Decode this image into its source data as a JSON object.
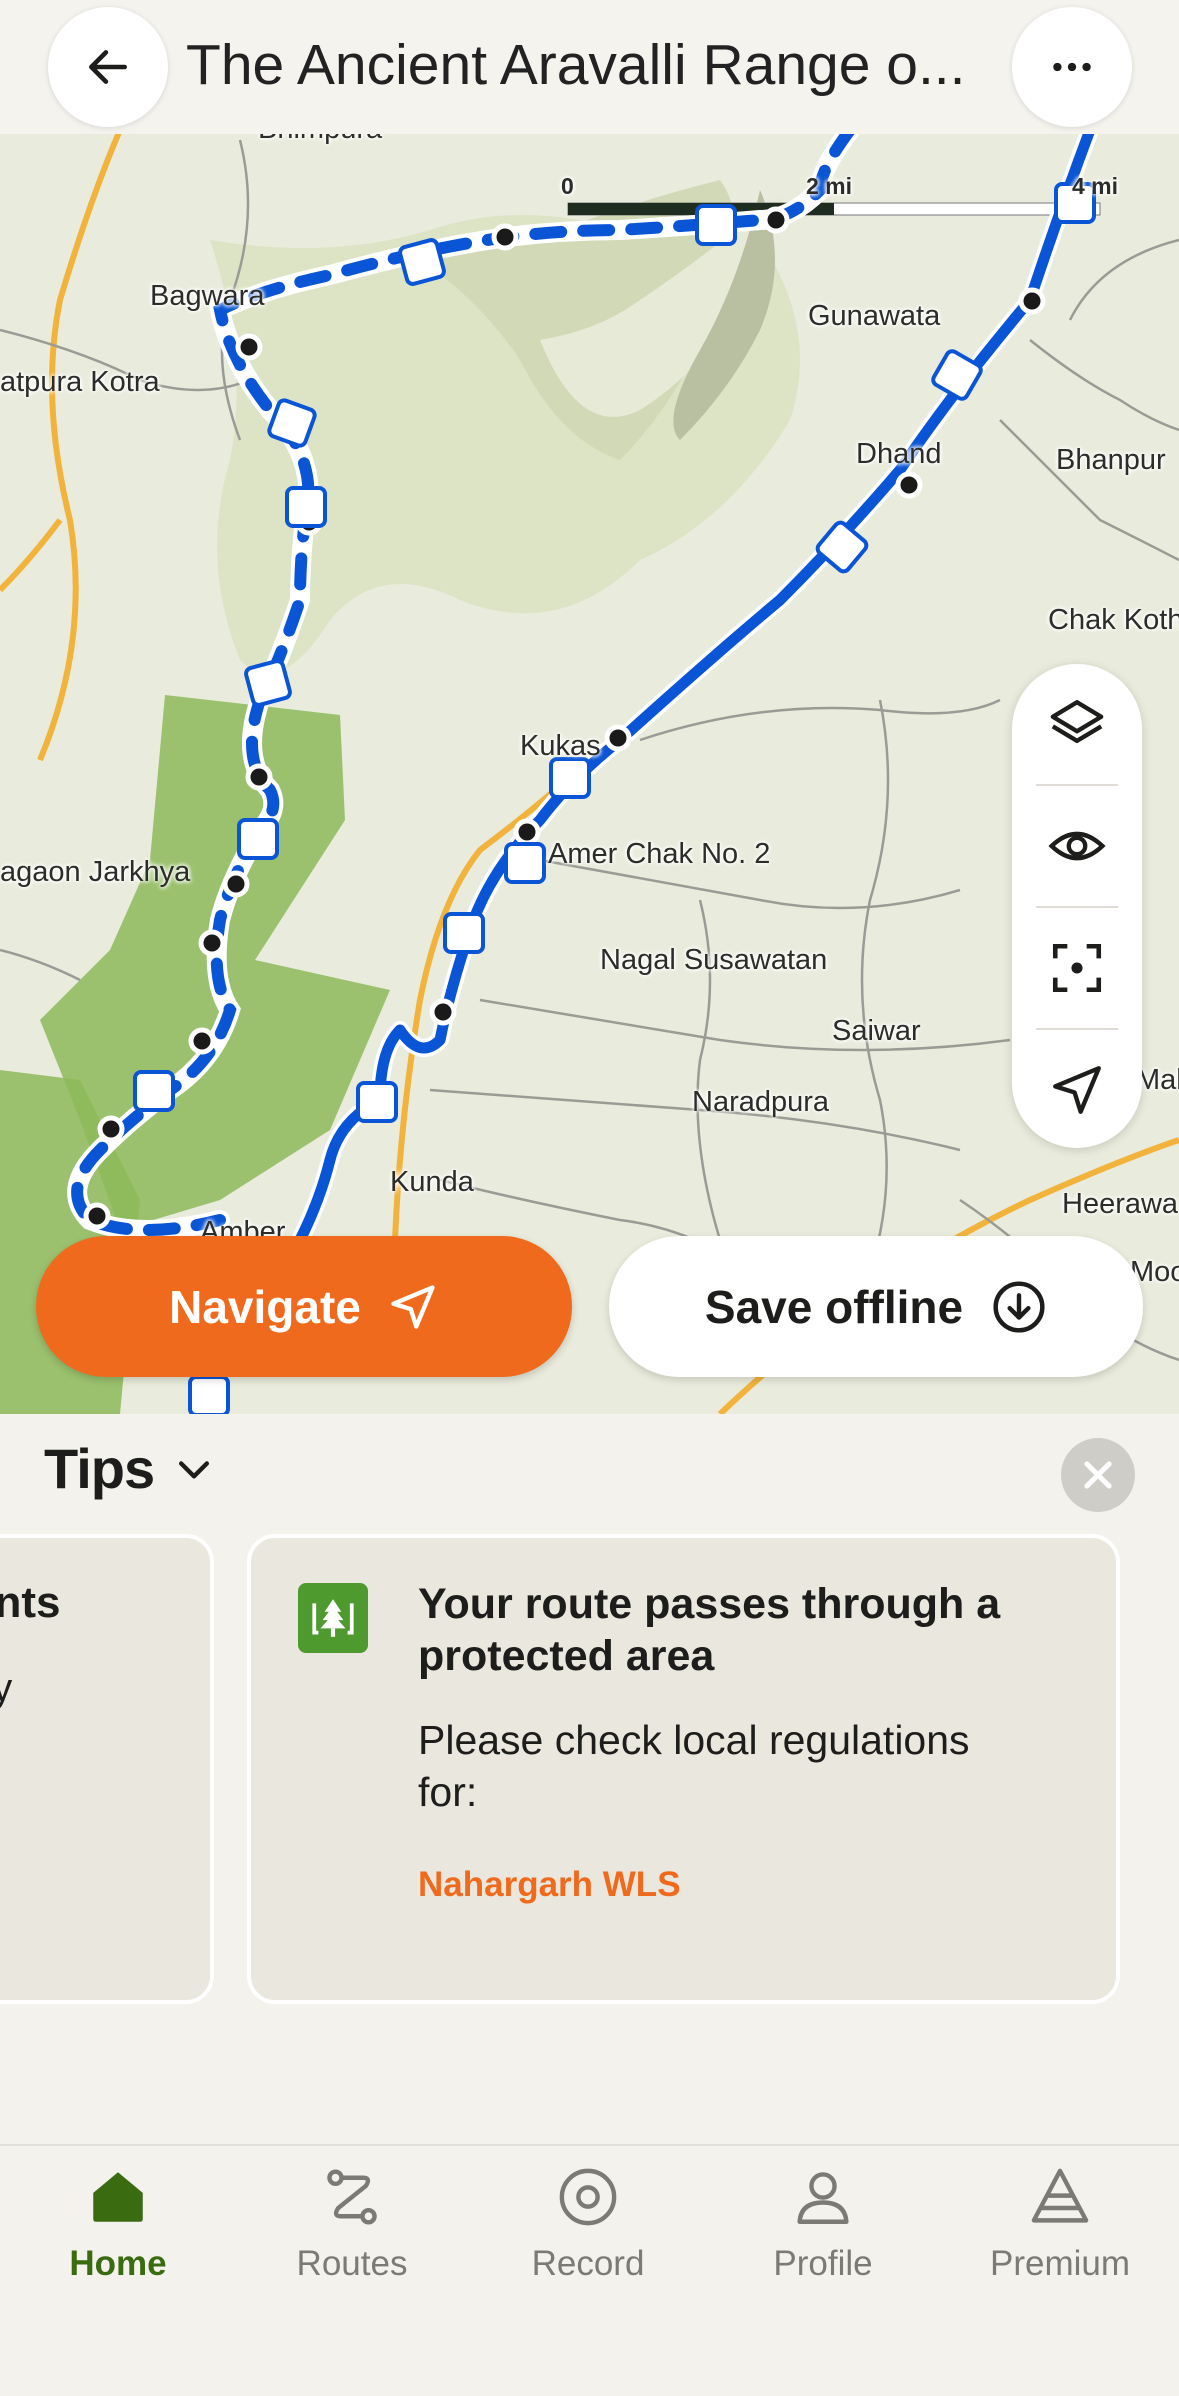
{
  "header": {
    "title": "The Ancient Aravalli Range o..."
  },
  "map": {
    "scale": {
      "labels": [
        "0",
        "2 mi",
        "4 mi"
      ]
    },
    "places": [
      "Bhimpura",
      "Bagwara",
      "atpura Kotra",
      "Gunawata",
      "Dhand",
      "Bhanpur",
      "Chak Koth",
      "Kukas",
      "Amer Chak No. 2",
      "agaon Jarkhya",
      "Nagal Susawatan",
      "Saiwar",
      "Naradpura",
      "Mal",
      "Kunda",
      "Heerawa",
      "Amber",
      "Moo"
    ],
    "controls": [
      "layers-icon",
      "eye-icon",
      "focus-icon",
      "locate-icon"
    ]
  },
  "actions": {
    "navigate_label": "Navigate",
    "save_offline_label": "Save offline"
  },
  "tips": {
    "title": "Tips",
    "left_card": {
      "title": "ents",
      "text": "ay"
    },
    "main_card": {
      "title": "Your route passes through a protected area",
      "body": "Please check local regulations for:",
      "link": "Nahargarh WLS"
    }
  },
  "nav": {
    "items": [
      {
        "label": "Home",
        "icon": "home-icon",
        "active": true
      },
      {
        "label": "Routes",
        "icon": "routes-icon",
        "active": false
      },
      {
        "label": "Record",
        "icon": "record-icon",
        "active": false
      },
      {
        "label": "Profile",
        "icon": "profile-icon",
        "active": false
      },
      {
        "label": "Premium",
        "icon": "premium-icon",
        "active": false
      }
    ]
  },
  "colors": {
    "accent": "#ef6a1c",
    "route": "#0a55d6",
    "active_nav": "#3b6b10",
    "protected_area": "#8dba5a"
  }
}
